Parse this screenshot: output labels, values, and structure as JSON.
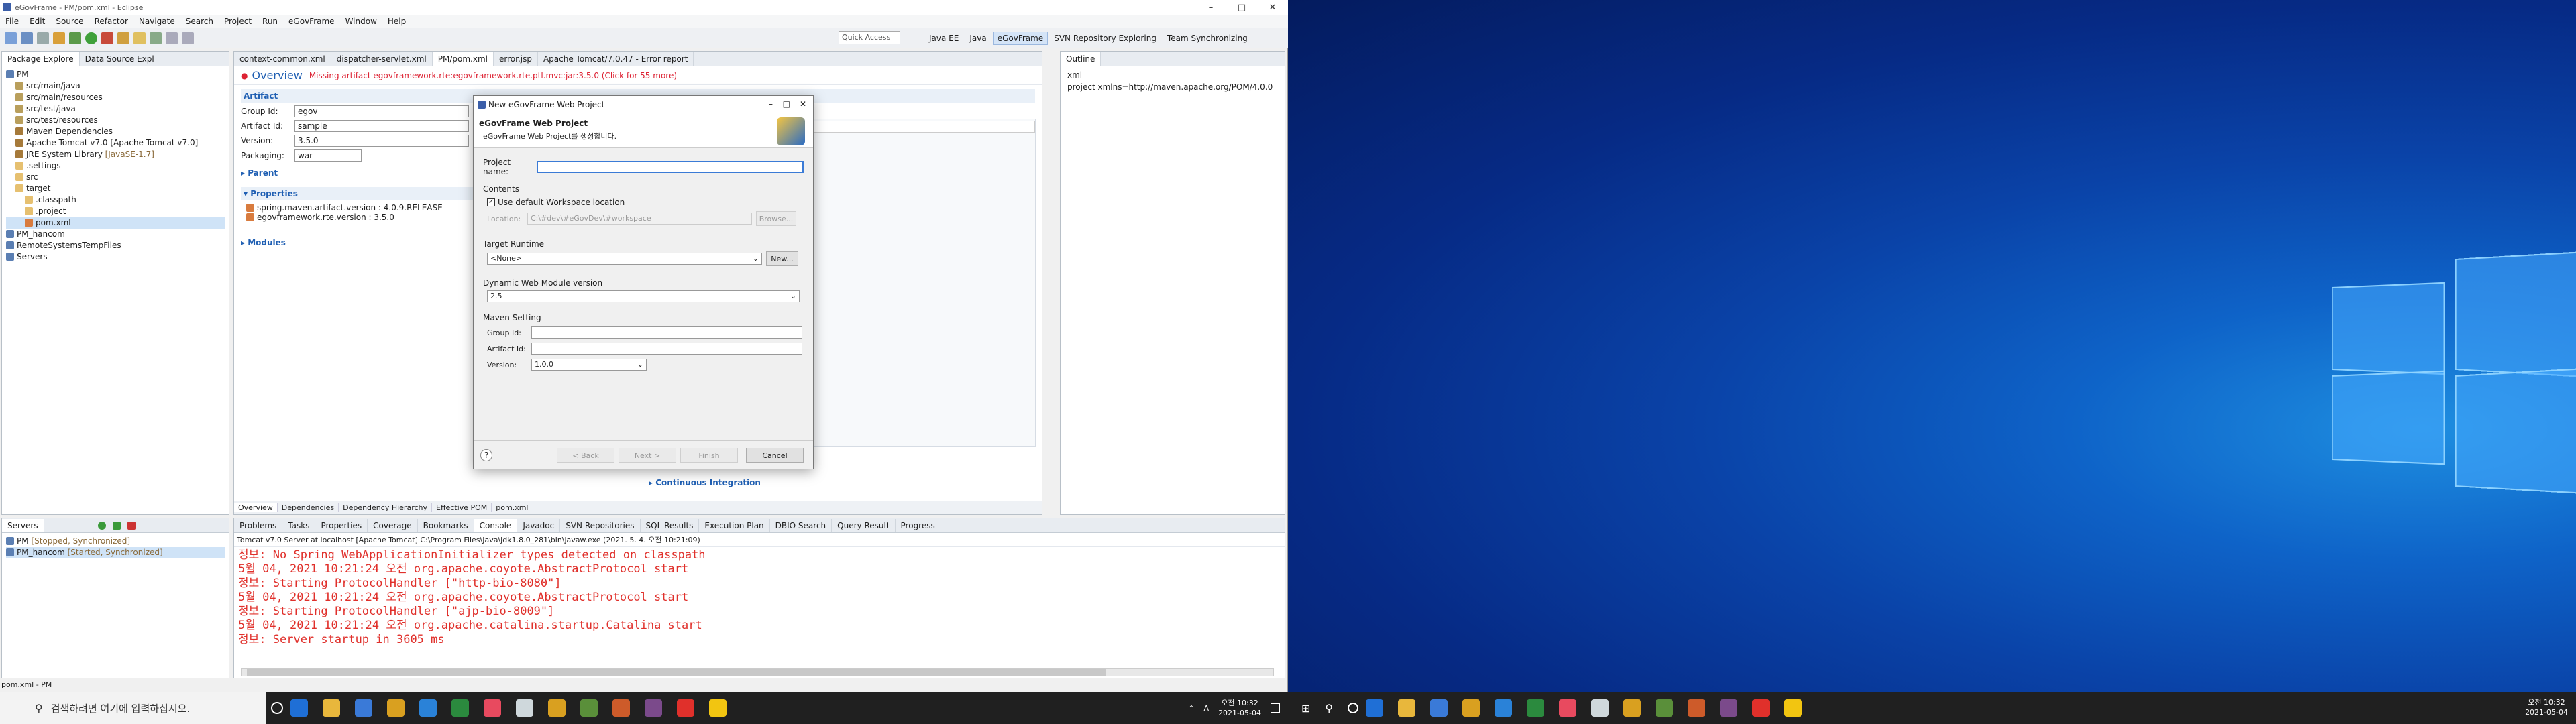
{
  "window": {
    "title": "eGovFrame - PM/pom.xml - Eclipse"
  },
  "menu": [
    "File",
    "Edit",
    "Source",
    "Refactor",
    "Navigate",
    "Search",
    "Project",
    "Run",
    "eGovFrame",
    "Window",
    "Help"
  ],
  "toolbar": {
    "quick_access": "Quick Access"
  },
  "perspectives": [
    "Java EE",
    "Java",
    "eGovFrame",
    "SVN Repository Exploring",
    "Team Synchronizing"
  ],
  "left_panel": {
    "tabs": [
      "Package Explore",
      "Data Source Expl"
    ],
    "tree": [
      {
        "label": "PM",
        "indent": 0,
        "icon": "project-icon"
      },
      {
        "label": "src/main/java",
        "indent": 1,
        "icon": "package-folder-icon"
      },
      {
        "label": "src/main/resources",
        "indent": 1,
        "icon": "package-folder-icon"
      },
      {
        "label": "src/test/java",
        "indent": 1,
        "icon": "package-folder-icon"
      },
      {
        "label": "src/test/resources",
        "indent": 1,
        "icon": "package-folder-icon"
      },
      {
        "label": "Maven Dependencies",
        "indent": 1,
        "icon": "library-icon"
      },
      {
        "label": "Apache Tomcat v7.0 [Apache Tomcat v7.0]",
        "indent": 1,
        "icon": "library-icon"
      },
      {
        "label": "JRE System Library",
        "suffix": " [JavaSE-1.7]",
        "indent": 1,
        "icon": "library-icon"
      },
      {
        "label": ".settings",
        "indent": 1,
        "icon": "folder-icon"
      },
      {
        "label": "src",
        "indent": 1,
        "icon": "folder-icon"
      },
      {
        "label": "target",
        "indent": 1,
        "icon": "folder-icon"
      },
      {
        "label": ".classpath",
        "indent": 2,
        "icon": "file-icon"
      },
      {
        "label": ".project",
        "indent": 2,
        "icon": "file-icon"
      },
      {
        "label": "pom.xml",
        "indent": 2,
        "icon": "xml-file-icon",
        "selected": true
      },
      {
        "label": "PM_hancom",
        "indent": 0,
        "icon": "project-icon"
      },
      {
        "label": "RemoteSystemsTempFiles",
        "indent": 0,
        "icon": "project-icon"
      },
      {
        "label": "Servers",
        "indent": 0,
        "icon": "project-icon"
      }
    ]
  },
  "editor": {
    "tabs": [
      "context-common.xml",
      "dispatcher-servlet.xml",
      "PM/pom.xml",
      "error.jsp",
      "Apache Tomcat/7.0.47 - Error report"
    ],
    "heading": "Overview",
    "error_msg": "Missing artifact egovframework.rte:egovframework.rte.ptl.mvc:jar:3.5.0 (Click for 55 more)",
    "artifact_section": "Artifact",
    "fields": [
      {
        "label": "Group Id:",
        "value": "egov"
      },
      {
        "label": "Artifact Id:",
        "value": "sample"
      },
      {
        "label": "Version:",
        "value": "3.5.0"
      },
      {
        "label": "Packaging:",
        "value": "war"
      }
    ],
    "parent_section": "Parent",
    "properties_section": "Properties",
    "properties": [
      "spring.maven.artifact.version : 4.0.9.RELEASE",
      "egovframework.rte.version : 3.5.0"
    ],
    "modules_section": "Modules",
    "ci_section": "Continuous Integration",
    "bottom_tabs": [
      "Overview",
      "Dependencies",
      "Dependency Hierarchy",
      "Effective POM",
      "pom.xml"
    ]
  },
  "outline": {
    "tab": "Outline",
    "items": [
      "xml",
      "project xmlns=http://maven.apache.org/POM/4.0.0"
    ]
  },
  "servers": {
    "tab": "Servers",
    "items": [
      {
        "name": "PM",
        "status": " [Stopped, Synchronized]"
      },
      {
        "name": "PM_hancom",
        "status": " [Started, Synchronized]"
      }
    ]
  },
  "console": {
    "tabs": [
      "Problems",
      "Tasks",
      "Properties",
      "Coverage",
      "Bookmarks",
      "Console",
      "Javadoc",
      "SVN Repositories",
      "SQL Results",
      "Execution Plan",
      "DBIO Search",
      "Query Result",
      "Progress"
    ],
    "header": "Tomcat v7.0 Server at localhost [Apache Tomcat] C:\\Program Files\\Java\\jdk1.8.0_281\\bin\\javaw.exe (2021. 5. 4. 오전 10:21:09)",
    "lines": [
      "정보: No Spring WebApplicationInitializer types detected on classpath",
      "5월 04, 2021 10:21:24 오전 org.apache.coyote.AbstractProtocol start",
      "정보: Starting ProtocolHandler [\"http-bio-8080\"]",
      "5월 04, 2021 10:21:24 오전 org.apache.coyote.AbstractProtocol start",
      "정보: Starting ProtocolHandler [\"ajp-bio-8009\"]",
      "5월 04, 2021 10:21:24 오전 org.apache.catalina.startup.Catalina start",
      "정보: Server startup in 3605 ms"
    ]
  },
  "statusbar": {
    "text": "pom.xml - PM"
  },
  "dialog": {
    "title": "New eGovFrame Web Project",
    "heading": "eGovFrame Web Project",
    "subheading": "eGovFrame Web Project를 생성합니다.",
    "project_name_label": "Project name:",
    "contents_label": "Contents",
    "use_default_label": "Use default Workspace location",
    "location_label": "Location:",
    "location_value": "C:\\#dev\\#eGovDev\\#workspace",
    "browse_label": "Browse...",
    "target_runtime_label": "Target Runtime",
    "target_runtime_value": "<None>",
    "new_label": "New...",
    "module_version_label": "Dynamic Web Module version",
    "module_version_value": "2.5",
    "maven_label": "Maven Setting",
    "group_label": "Group Id:",
    "artifact_label": "Artifact Id:",
    "version_label": "Version:",
    "version_value": "1.0.0",
    "back": "< Back",
    "next": "Next >",
    "finish": "Finish",
    "cancel": "Cancel"
  },
  "taskbar_left": {
    "search_placeholder": "검색하려면 여기에 입력하십시오.",
    "time": "오전 10:32",
    "date": "2021-05-04",
    "lang": "A"
  },
  "taskbar_right": {
    "time": "오전 10:32",
    "date": "2021-05-04"
  }
}
